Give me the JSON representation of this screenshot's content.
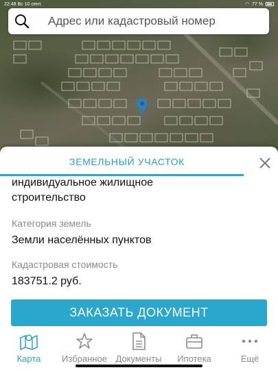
{
  "status_bar": {
    "time": "22:48",
    "date": "Вс 10 сент.",
    "battery": "77 %"
  },
  "search": {
    "placeholder": "Адрес или кадастровый номер"
  },
  "sheet": {
    "title": "ЗЕМЕЛЬНЫЙ УЧАСТОК",
    "usage_line1": "индивидуальное жилищное",
    "usage_line2": "строительство",
    "land_category_label": "Категория земель",
    "land_category_value": "Земли населённых пунктов",
    "cadastral_cost_label": "Кадастровая стоимость",
    "cadastral_cost_value": "183751.2 руб.",
    "order_button": "ЗАКАЗАТЬ ДОКУМЕНТ"
  },
  "tabs": [
    {
      "label": "Карта",
      "icon": "map-icon",
      "active": true
    },
    {
      "label": "Избранное",
      "icon": "star-icon",
      "active": false
    },
    {
      "label": "Документы",
      "icon": "document-icon",
      "active": false
    },
    {
      "label": "Ипотека",
      "icon": "briefcase-icon",
      "active": false
    },
    {
      "label": "Ещё",
      "icon": "more-icon",
      "active": false
    }
  ],
  "colors": {
    "accent": "#2ba6cc",
    "pin": "#2f7fb6"
  }
}
